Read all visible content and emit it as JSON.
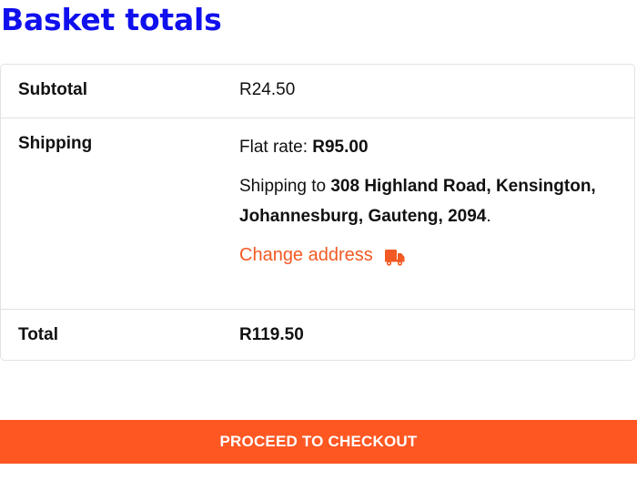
{
  "heading": "Basket totals",
  "subtotal": {
    "label": "Subtotal",
    "value": "R24.50"
  },
  "shipping": {
    "label": "Shipping",
    "method_prefix": "Flat rate: ",
    "method_price": "R95.00",
    "destination_prefix": "Shipping to ",
    "destination_address": "308 Highland Road, Kensington, Johannesburg, Gauteng, 2094",
    "destination_suffix": ".",
    "change_address_label": "Change address",
    "change_address_icon": "truck-icon"
  },
  "total": {
    "label": "Total",
    "value": "R119.50"
  },
  "checkout_button_label": "PROCEED TO CHECKOUT",
  "colors": {
    "heading": "#1010ee",
    "accent": "#fe5722",
    "link": "#f15a24",
    "border": "#e2e2e2"
  }
}
